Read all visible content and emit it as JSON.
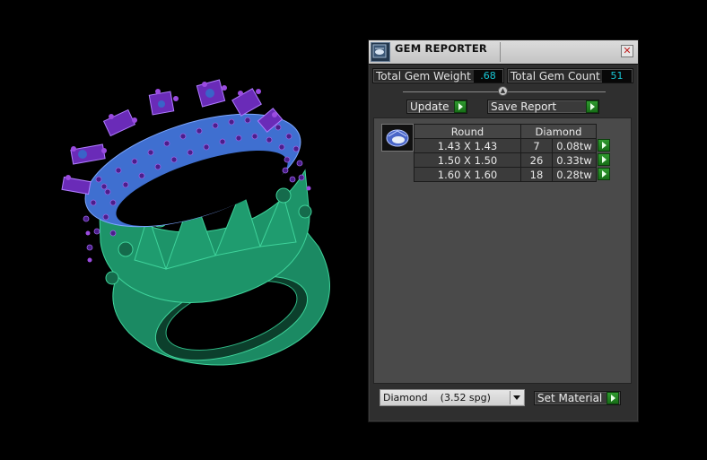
{
  "window": {
    "title": "GEM REPORTER",
    "close_symbol": "✕"
  },
  "summary": {
    "weight_label": "Total Gem Weight",
    "weight_value": ".68",
    "count_label": "Total Gem Count",
    "count_value": "51"
  },
  "toolbar": {
    "update_label": "Update",
    "save_label": "Save Report"
  },
  "gem_table": {
    "shape_header": "Round",
    "material_header": "Diamond",
    "rows": [
      {
        "size": "1.43 X 1.43",
        "count": "7",
        "weight": "0.08tw"
      },
      {
        "size": "1.50 X 1.50",
        "count": "26",
        "weight": "0.33tw"
      },
      {
        "size": "1.60 X 1.60",
        "count": "18",
        "weight": "0.28tw"
      }
    ]
  },
  "material": {
    "selected": "Diamond    (3.52 spg)",
    "set_label": "Set Material"
  },
  "icons": {
    "app": "gem-reporter-app-icon",
    "thumb": "round-diamond-icon",
    "go": "green-play-arrow-icon"
  },
  "colors": {
    "value_text": "#18c8d6",
    "ring_metal": "#1b8a63",
    "gem_blue": "#4a74d6",
    "prong_purple": "#7a2fc0"
  }
}
